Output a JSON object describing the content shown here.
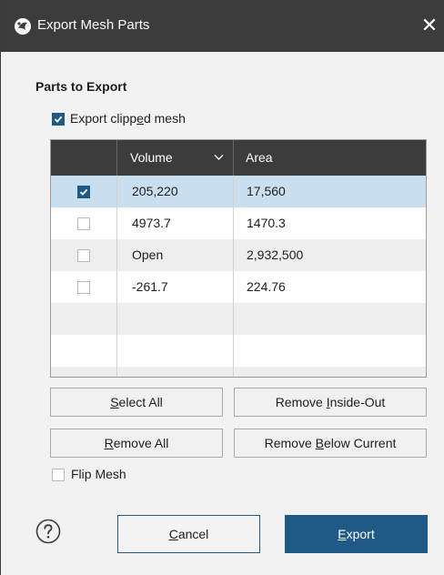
{
  "window": {
    "title": "Export Mesh Parts",
    "close_glyph": "✕"
  },
  "section": {
    "parts_label": "Parts to Export"
  },
  "export_clipped": {
    "pre": "Export clipp",
    "mnemonic": "e",
    "post": "d mesh",
    "checked": true
  },
  "table": {
    "columns": [
      {
        "label": "",
        "name": "checkbox-column"
      },
      {
        "label": "Volume",
        "name": "volume-column",
        "sort_icon": "chevron-down-icon"
      },
      {
        "label": "Area",
        "name": "area-column"
      }
    ],
    "rows": [
      {
        "checked": true,
        "volume": "205,220",
        "area": "17,560"
      },
      {
        "checked": false,
        "volume": "4973.7",
        "area": "1470.3"
      },
      {
        "checked": false,
        "volume": "Open",
        "area": "2,932,500"
      },
      {
        "checked": false,
        "volume": "-261.7",
        "area": "224.76"
      }
    ]
  },
  "buttons": {
    "select_all": {
      "mnemonic": "S",
      "post": "elect All"
    },
    "remove_inside_out": {
      "pre": "Remove ",
      "mnemonic": "I",
      "post": "nside-Out"
    },
    "remove_all": {
      "mnemonic": "R",
      "post": "emove All"
    },
    "remove_below": {
      "pre": "Remove ",
      "mnemonic": "B",
      "post": "elow Current"
    },
    "cancel": {
      "mnemonic": "C",
      "post": "ancel"
    },
    "export": {
      "mnemonic": "E",
      "post": "xport"
    }
  },
  "flip_mesh": {
    "label": "Flip Mesh",
    "checked": false
  },
  "colors": {
    "titlebar": "#3c3c3c",
    "accent": "#1f5a86",
    "selected_row": "#c9dff0",
    "dialog_bg": "#f2f2f2"
  },
  "icons": {
    "app": "leapfrog-app-icon",
    "help": "help-icon",
    "close": "close-icon"
  }
}
